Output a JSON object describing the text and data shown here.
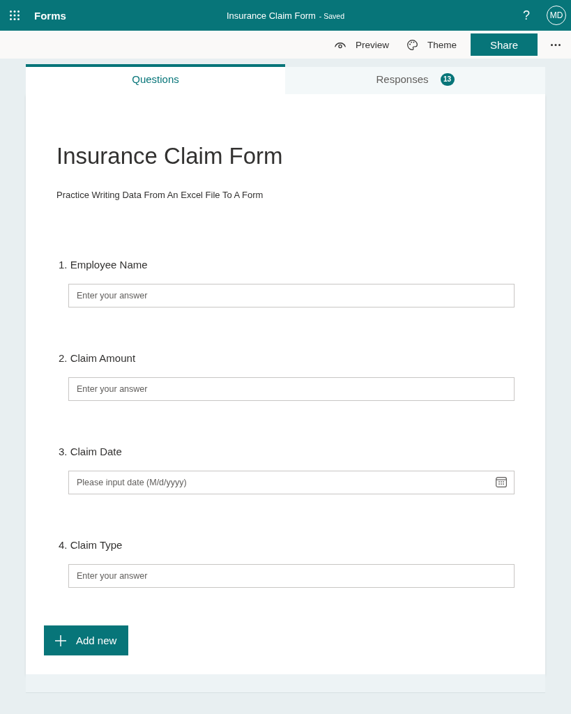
{
  "app_bar": {
    "app_name": "Forms",
    "form_title": "Insurance Claim Form",
    "save_status": "- Saved",
    "help_label": "?",
    "avatar_initials": "MD"
  },
  "command_bar": {
    "actions": [
      {
        "kind": "preview",
        "label": "Preview"
      },
      {
        "kind": "theme",
        "label": "Theme"
      }
    ],
    "share_label": "Share"
  },
  "tabs": [
    {
      "label": "Questions",
      "selected": true
    },
    {
      "label": "Responses",
      "selected": false,
      "count": "13"
    }
  ],
  "form": {
    "title": "Insurance Claim Form",
    "description": "Practice Writing Data From An Excel File To A Form",
    "questions": [
      {
        "number": "1.",
        "label": "Employee Name",
        "kind": "text",
        "placeholder": "Enter your answer"
      },
      {
        "number": "2.",
        "label": "Claim Amount",
        "kind": "text",
        "placeholder": "Enter your answer"
      },
      {
        "number": "3.",
        "label": "Claim Date",
        "kind": "date",
        "placeholder": "Please input date (M/d/yyyy)"
      },
      {
        "number": "4.",
        "label": "Claim Type",
        "kind": "text",
        "placeholder": "Enter your answer"
      }
    ]
  },
  "add_button": {
    "label": "Add new"
  }
}
